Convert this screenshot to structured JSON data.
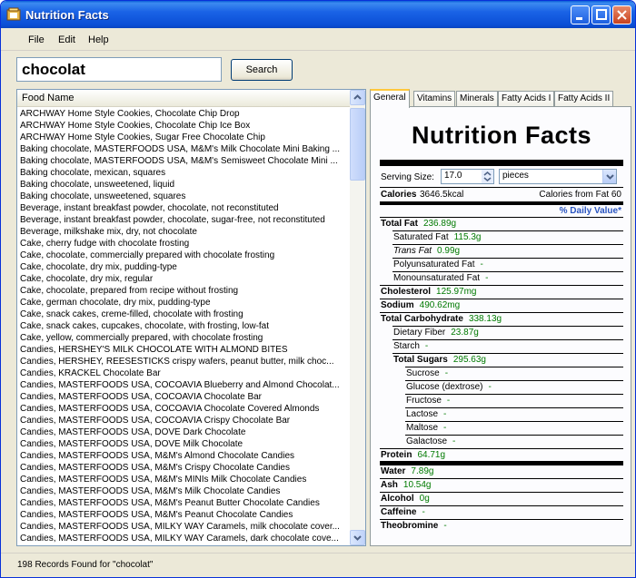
{
  "window": {
    "title": "Nutrition Facts"
  },
  "menu": {
    "items": [
      "File",
      "Edit",
      "Help"
    ]
  },
  "search": {
    "value": "chocolat",
    "button_label": "Search"
  },
  "list": {
    "column_header": "Food Name",
    "items": [
      "ARCHWAY Home Style Cookies, Chocolate Chip Drop",
      "ARCHWAY Home Style Cookies, Chocolate Chip Ice Box",
      "ARCHWAY Home Style Cookies, Sugar Free Chocolate Chip",
      "Baking chocolate, MASTERFOODS USA, M&M's Milk Chocolate Mini Baking ...",
      "Baking chocolate, MASTERFOODS USA, M&M's Semisweet Chocolate Mini ...",
      "Baking chocolate, mexican, squares",
      "Baking chocolate, unsweetened, liquid",
      "Baking chocolate, unsweetened, squares",
      "Beverage, instant breakfast powder, chocolate, not reconstituted",
      "Beverage, instant breakfast powder, chocolate, sugar-free, not reconstituted",
      "Beverage, milkshake mix, dry, not chocolate",
      "Cake, cherry fudge with chocolate frosting",
      "Cake, chocolate, commercially prepared with chocolate frosting",
      "Cake, chocolate, dry mix, pudding-type",
      "Cake, chocolate, dry mix, regular",
      "Cake, chocolate, prepared from recipe without frosting",
      "Cake, german chocolate, dry mix, pudding-type",
      "Cake, snack cakes, creme-filled, chocolate with frosting",
      "Cake, snack cakes, cupcakes, chocolate, with frosting, low-fat",
      "Cake, yellow, commercially prepared, with chocolate frosting",
      "Candies, HERSHEY'S MILK CHOCOLATE WITH ALMOND BITES",
      "Candies, HERSHEY, REESESTICKS  crispy wafers, peanut butter, milk choc...",
      "Candies, KRACKEL Chocolate Bar",
      "Candies, MASTERFOODS USA, COCOAVIA Blueberry and Almond Chocolat...",
      "Candies, MASTERFOODS USA, COCOAVIA Chocolate Bar",
      "Candies, MASTERFOODS USA, COCOAVIA Chocolate Covered Almonds",
      "Candies, MASTERFOODS USA, COCOAVIA Crispy Chocolate Bar",
      "Candies, MASTERFOODS USA, DOVE Dark Chocolate",
      "Candies, MASTERFOODS USA, DOVE Milk Chocolate",
      "Candies, MASTERFOODS USA, M&M's Almond Chocolate Candies",
      "Candies, MASTERFOODS USA, M&M's Crispy Chocolate Candies",
      "Candies, MASTERFOODS USA, M&M's MINIs Milk Chocolate Candies",
      "Candies, MASTERFOODS USA, M&M's Milk Chocolate Candies",
      "Candies, MASTERFOODS USA, M&M's Peanut Butter Chocolate Candies",
      "Candies, MASTERFOODS USA, M&M's Peanut Chocolate Candies",
      "Candies, MASTERFOODS USA, MILKY WAY Caramels, milk chocolate cover...",
      "Candies, MASTERFOODS USA, MILKY WAY Caramels, dark chocolate cove..."
    ]
  },
  "tabs": [
    "General",
    "Vitamins",
    "Minerals",
    "Fatty Acids I",
    "Fatty Acids II"
  ],
  "label": {
    "title": "Nutrition Facts",
    "serving_size_label": "Serving Size:",
    "serving_size_value": "17.0",
    "serving_unit": "pieces",
    "calories_label": "Calories",
    "calories_value": "3646.5kcal",
    "calories_from_fat": "Calories from Fat 60",
    "daily_value_header": "% Daily Value*",
    "nutrients": [
      {
        "name": "Total Fat",
        "value": "236.89g",
        "bold": true
      },
      {
        "name": "Saturated Fat",
        "value": "115.3g",
        "bold": false
      },
      {
        "name": "Trans Fat",
        "value": "0.99g",
        "bold": false
      },
      {
        "name": "Polyunsaturated Fat",
        "value": "-",
        "bold": false
      },
      {
        "name": "Monounsaturated Fat",
        "value": "-",
        "bold": false
      },
      {
        "name": "Cholesterol",
        "value": "125.97mg",
        "bold": true
      },
      {
        "name": "Sodium",
        "value": "490.62mg",
        "bold": true
      },
      {
        "name": "Total Carbohydrate",
        "value": "338.13g",
        "bold": true
      },
      {
        "name": "Dietary Fiber",
        "value": "23.87g",
        "bold": false
      },
      {
        "name": "Starch",
        "value": "-",
        "bold": false
      },
      {
        "name": "Total Sugars",
        "value": "295.63g",
        "bold": true
      },
      {
        "name": "Sucrose",
        "value": "-",
        "bold": false
      },
      {
        "name": "Glucose (dextrose)",
        "value": "-",
        "bold": false
      },
      {
        "name": "Fructose",
        "value": "-",
        "bold": false
      },
      {
        "name": "Lactose",
        "value": "-",
        "bold": false
      },
      {
        "name": "Maltose",
        "value": "-",
        "bold": false
      },
      {
        "name": "Galactose",
        "value": "-",
        "bold": false
      },
      {
        "name": "Protein",
        "value": "64.71g",
        "bold": true
      },
      {
        "name": "Water",
        "value": "7.89g",
        "bold": true
      },
      {
        "name": "Ash",
        "value": "10.54g",
        "bold": true
      },
      {
        "name": "Alcohol",
        "value": "0g",
        "bold": true
      },
      {
        "name": "Caffeine",
        "value": "-",
        "bold": true
      },
      {
        "name": "Theobromine",
        "value": "-",
        "bold": true
      }
    ]
  },
  "status": {
    "text": "198 Records Found  for \"chocolat\""
  }
}
